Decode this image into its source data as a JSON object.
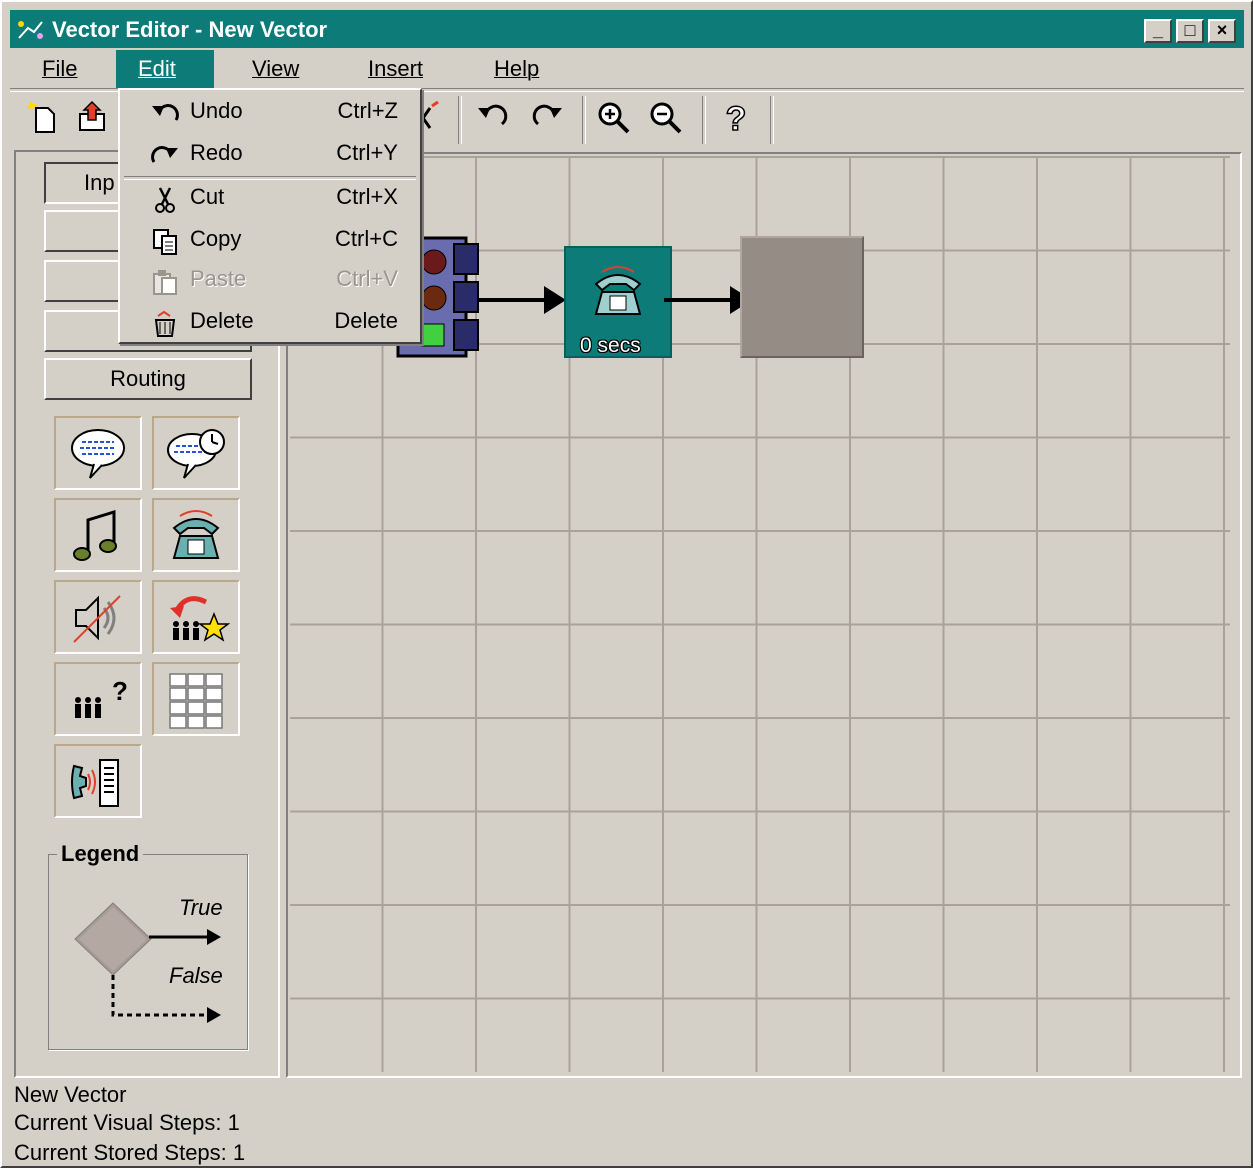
{
  "window": {
    "title": "Vector Editor - New Vector",
    "controls": [
      "_",
      "□",
      "×"
    ]
  },
  "menubar": [
    {
      "label": "File"
    },
    {
      "label": "Edit"
    },
    {
      "label": "View"
    },
    {
      "label": "Insert"
    },
    {
      "label": "Help"
    }
  ],
  "edit_menu": [
    {
      "label": "Undo",
      "shortcut": "Ctrl+Z",
      "icon": "undo-icon",
      "enabled": true
    },
    {
      "label": "Redo",
      "shortcut": "Ctrl+Y",
      "icon": "redo-icon",
      "enabled": true
    },
    {
      "label": "Cut",
      "shortcut": "Ctrl+X",
      "icon": "scissors-icon",
      "enabled": true
    },
    {
      "label": "Copy",
      "shortcut": "Ctrl+C",
      "icon": "copy-icon",
      "enabled": true
    },
    {
      "label": "Paste",
      "shortcut": "Ctrl+V",
      "icon": "paste-icon",
      "enabled": false
    },
    {
      "label": "Delete",
      "shortcut": "Delete",
      "icon": "trash-icon",
      "enabled": true
    }
  ],
  "toolbar": [
    "new-icon",
    "open-icon",
    "delete-icon",
    "undo-icon",
    "redo-icon",
    "zoom-in-icon",
    "zoom-out-icon",
    "help-icon"
  ],
  "left_panel": {
    "category_buttons": [
      "Inp",
      "",
      "",
      "",
      "Routing"
    ],
    "palette": [
      "announcement-icon",
      "timed-announcement-icon",
      "music-icon",
      "phone-icon",
      "silence-icon",
      "route-to-skill-icon",
      "queue-query-icon",
      "keypad-icon",
      "phone-device-icon"
    ],
    "legend": {
      "title": "Legend",
      "true_label": "True",
      "false_label": "False"
    }
  },
  "canvas": {
    "nodes": [
      {
        "type": "traffic-light-icon"
      },
      {
        "type": "wait-phone-node",
        "label": "0 secs"
      },
      {
        "type": "empty-step-node"
      }
    ]
  },
  "status": {
    "name": "New Vector",
    "visual_steps": "Current Visual Steps: 1",
    "stored_steps": "Current Stored Steps: 1"
  },
  "colors": {
    "title_bar": "#0d7b78",
    "face": "#d4d0c8",
    "grid": "#a8a29a",
    "node_teal": "#0d7b78",
    "node_gray": "#958d85"
  }
}
